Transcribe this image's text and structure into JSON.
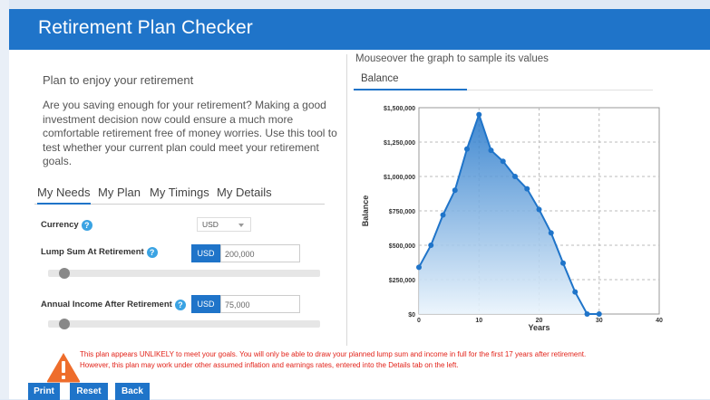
{
  "header": {
    "title": "Retirement Plan Checker"
  },
  "left": {
    "subtitle": "Plan to enjoy your retirement",
    "intro": "Are you saving enough for your retirement? Making a good investment decision now could ensure a much more comfortable retirement free of money worries. Use this tool to test whether your current plan could meet your retirement goals."
  },
  "tabs": [
    {
      "label": "My Needs",
      "active": true
    },
    {
      "label": "My Plan",
      "active": false
    },
    {
      "label": "My Timings",
      "active": false
    },
    {
      "label": "My Details",
      "active": false
    }
  ],
  "needs": {
    "currency_label": "Currency",
    "currency_value": "USD",
    "lump_label": "Lump Sum At Retirement",
    "lump_currency": "USD",
    "lump_value": "200,000",
    "lump_slider_fraction": 0.04,
    "income_label": "Annual Income After Retirement",
    "income_currency": "USD",
    "income_value": "75,000",
    "income_slider_fraction": 0.04,
    "help_glyph": "?"
  },
  "chart_panel": {
    "hint": "Mouseover the graph to sample its values",
    "tab_label": "Balance"
  },
  "chart_data": {
    "type": "area",
    "title": "",
    "xlabel": "Years",
    "ylabel": "Balance",
    "xlim": [
      0,
      40
    ],
    "ylim": [
      0,
      1500000
    ],
    "x_ticks": [
      0,
      10,
      20,
      30,
      40
    ],
    "y_ticks": [
      0,
      250000,
      500000,
      750000,
      1000000,
      1250000,
      1500000
    ],
    "y_tick_labels": [
      "$0",
      "$250,000",
      "$500,000",
      "$750,000",
      "$1,000,000",
      "$1,250,000",
      "$1,500,000"
    ],
    "grid": true,
    "colors": {
      "line": "#1f74c9",
      "fill_top": "#1f74c9",
      "fill_bottom": "#eaf4fc"
    },
    "series": [
      {
        "x": [
          0,
          2,
          4,
          6,
          8,
          10,
          12,
          14,
          16,
          18,
          20,
          22,
          24,
          26,
          28,
          30
        ],
        "values": [
          340000,
          500000,
          720000,
          900000,
          1200000,
          1450000,
          1190000,
          1110000,
          1000000,
          910000,
          760000,
          590000,
          370000,
          160000,
          0,
          0
        ]
      }
    ]
  },
  "warning": {
    "icon": "warning-triangle-icon",
    "line1": "This plan appears UNLIKELY to meet your goals. You will only be able to draw your planned lump sum and income in full for the first 17 years after retirement.",
    "line2": "However, this plan may work under other assumed inflation and earnings rates, entered into the Details tab on the left."
  },
  "buttons": {
    "print": "Print",
    "reset": "Reset",
    "back": "Back"
  }
}
